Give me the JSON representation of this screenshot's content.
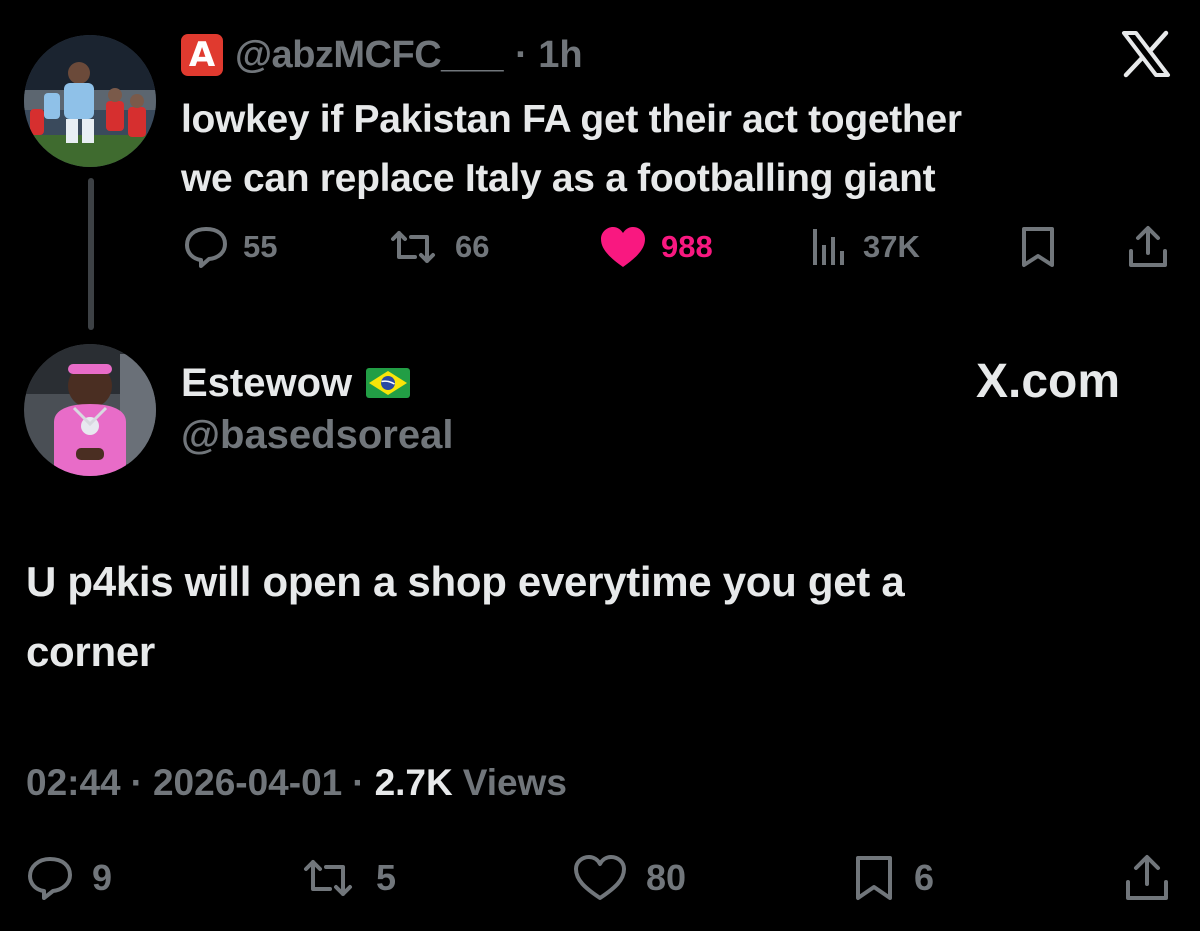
{
  "parent_tweet": {
    "badge_letter": "A",
    "handle": "@abzMCFC___",
    "time": "· 1h",
    "text_line1": "lowkey if Pakistan FA get their act together",
    "text_line2": "we can replace Italy as a footballing giant",
    "replies": "55",
    "reposts": "66",
    "likes": "988",
    "views": "37K",
    "icons": [
      "x-logo-icon",
      "reply-icon",
      "repost-icon",
      "heart-filled-icon",
      "views-icon",
      "bookmark-icon",
      "share-icon"
    ],
    "like_color": "#f91880"
  },
  "main_tweet": {
    "name": "Estewow",
    "flag": "brazil-flag-icon",
    "handle": "@basedsoreal",
    "watermark": "X.com",
    "text_line1": "U p4kis will open a shop everytime you get a",
    "text_line2": "corner",
    "time": "02:44",
    "date": "2026-04-01",
    "views_count": "2.7K",
    "views_label": "Views",
    "replies": "9",
    "reposts": "5",
    "likes": "80",
    "bookmarks": "6",
    "icons": [
      "reply-icon",
      "repost-icon",
      "heart-icon",
      "bookmark-icon",
      "share-icon"
    ]
  },
  "colors": {
    "background": "#000000",
    "text": "#e7e9ea",
    "secondary": "#71767b",
    "like": "#f91880"
  }
}
